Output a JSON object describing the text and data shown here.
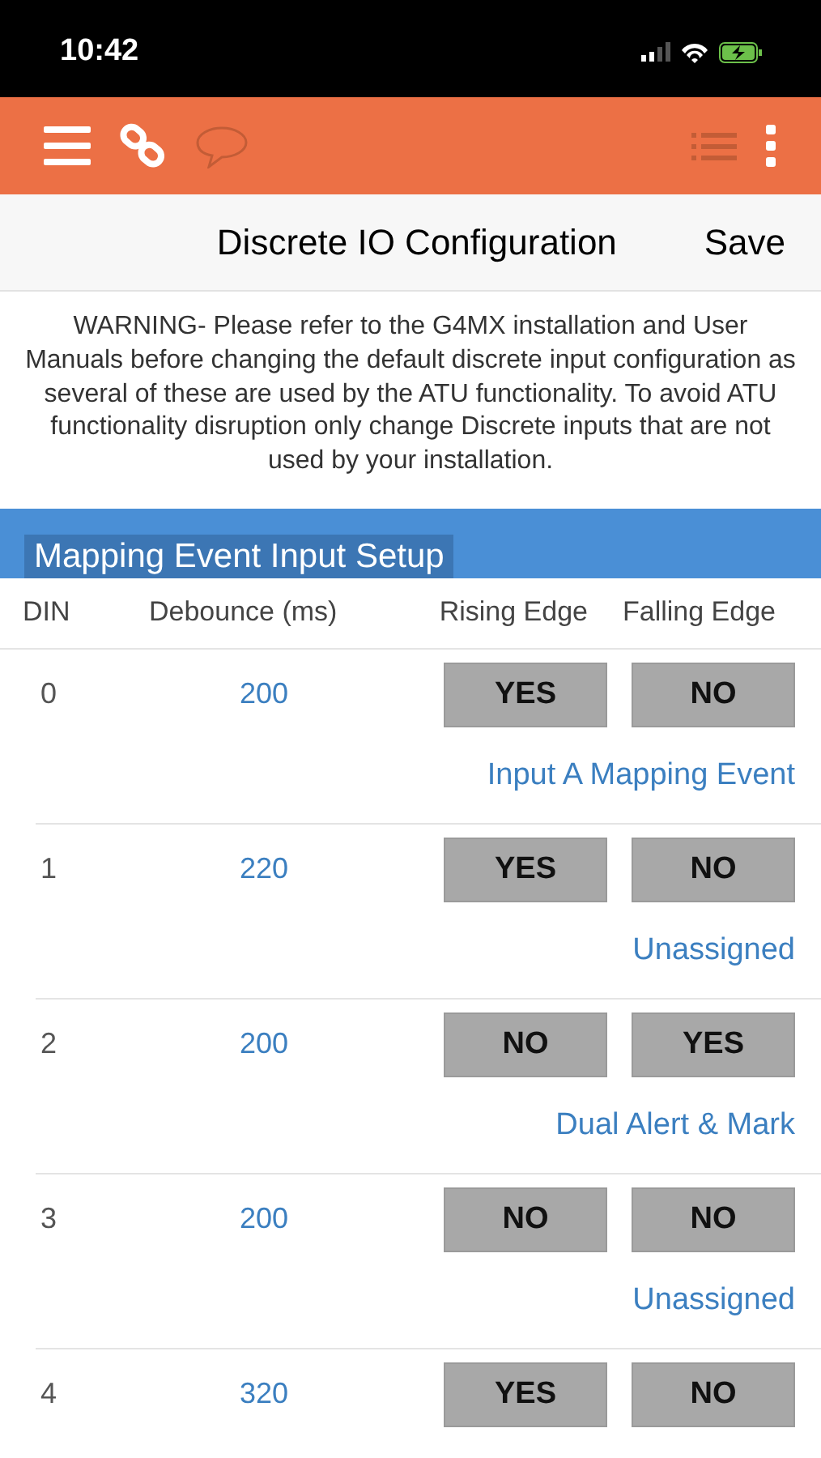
{
  "status_bar": {
    "time": "10:42"
  },
  "toolbar": {
    "icons": [
      {
        "kind": "menu",
        "disabled": false
      },
      {
        "kind": "link",
        "disabled": false
      },
      {
        "kind": "chat",
        "disabled": true
      },
      {
        "kind": "list",
        "disabled": true
      },
      {
        "kind": "more",
        "disabled": false
      }
    ]
  },
  "nav": {
    "title": "Discrete IO Configuration",
    "action": "Save"
  },
  "warning": "WARNING- Please refer to the G4MX installation and User Manuals before changing the default discrete input configuration as several of these are used by the ATU functionality. To avoid ATU functionality disruption only change Discrete inputs that are not used by your installation.",
  "section": {
    "title": "Mapping Event Input Setup"
  },
  "table": {
    "columns": [
      "DIN",
      "Debounce (ms)",
      "Rising Edge",
      "Falling Edge"
    ],
    "rows": [
      {
        "din": "0",
        "debounce": "200",
        "rising": "YES",
        "falling": "NO",
        "assignment": "Input A Mapping Event"
      },
      {
        "din": "1",
        "debounce": "220",
        "rising": "YES",
        "falling": "NO",
        "assignment": "Unassigned"
      },
      {
        "din": "2",
        "debounce": "200",
        "rising": "NO",
        "falling": "YES",
        "assignment": "Dual Alert & Mark"
      },
      {
        "din": "3",
        "debounce": "200",
        "rising": "NO",
        "falling": "NO",
        "assignment": "Unassigned"
      },
      {
        "din": "4",
        "debounce": "320",
        "rising": "YES",
        "falling": "NO"
      }
    ]
  }
}
